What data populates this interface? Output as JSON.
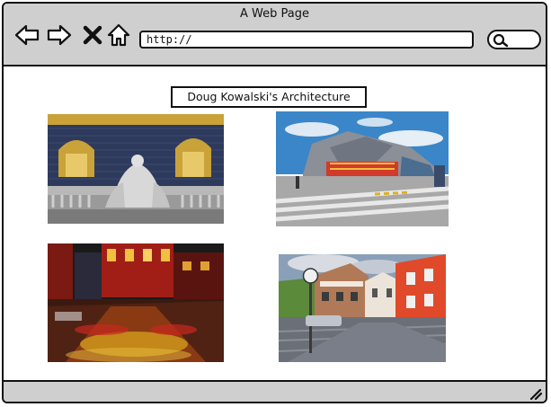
{
  "window": {
    "title": "A Web Page"
  },
  "toolbar": {
    "back_icon": "back-arrow-icon",
    "forward_icon": "forward-arrow-icon",
    "stop_icon": "close-x-icon",
    "home_icon": "home-icon",
    "search_icon": "search-icon"
  },
  "address_bar": {
    "value": "http://"
  },
  "page": {
    "heading": "Doug Kowalski's Architecture",
    "photos": [
      {
        "subject": "ornate baroque building facade with gold window frames and sculptures",
        "colors": [
          "#2b3550",
          "#c9a23a",
          "#9a9a9a"
        ]
      },
      {
        "subject": "modern angular glass building with plaza and crosswalk",
        "colors": [
          "#3a86c8",
          "#8a8f98",
          "#d23a2a"
        ]
      },
      {
        "subject": "wet city street at night with red and yellow lights",
        "colors": [
          "#1a1a1a",
          "#c8281e",
          "#d6a21e"
        ]
      },
      {
        "subject": "cobblestone alpine town square with colorful buildings",
        "colors": [
          "#6b6f78",
          "#e04a2a",
          "#8aa0b8"
        ]
      }
    ]
  },
  "statusbar": {
    "grip_icon": "resize-grip-icon"
  }
}
